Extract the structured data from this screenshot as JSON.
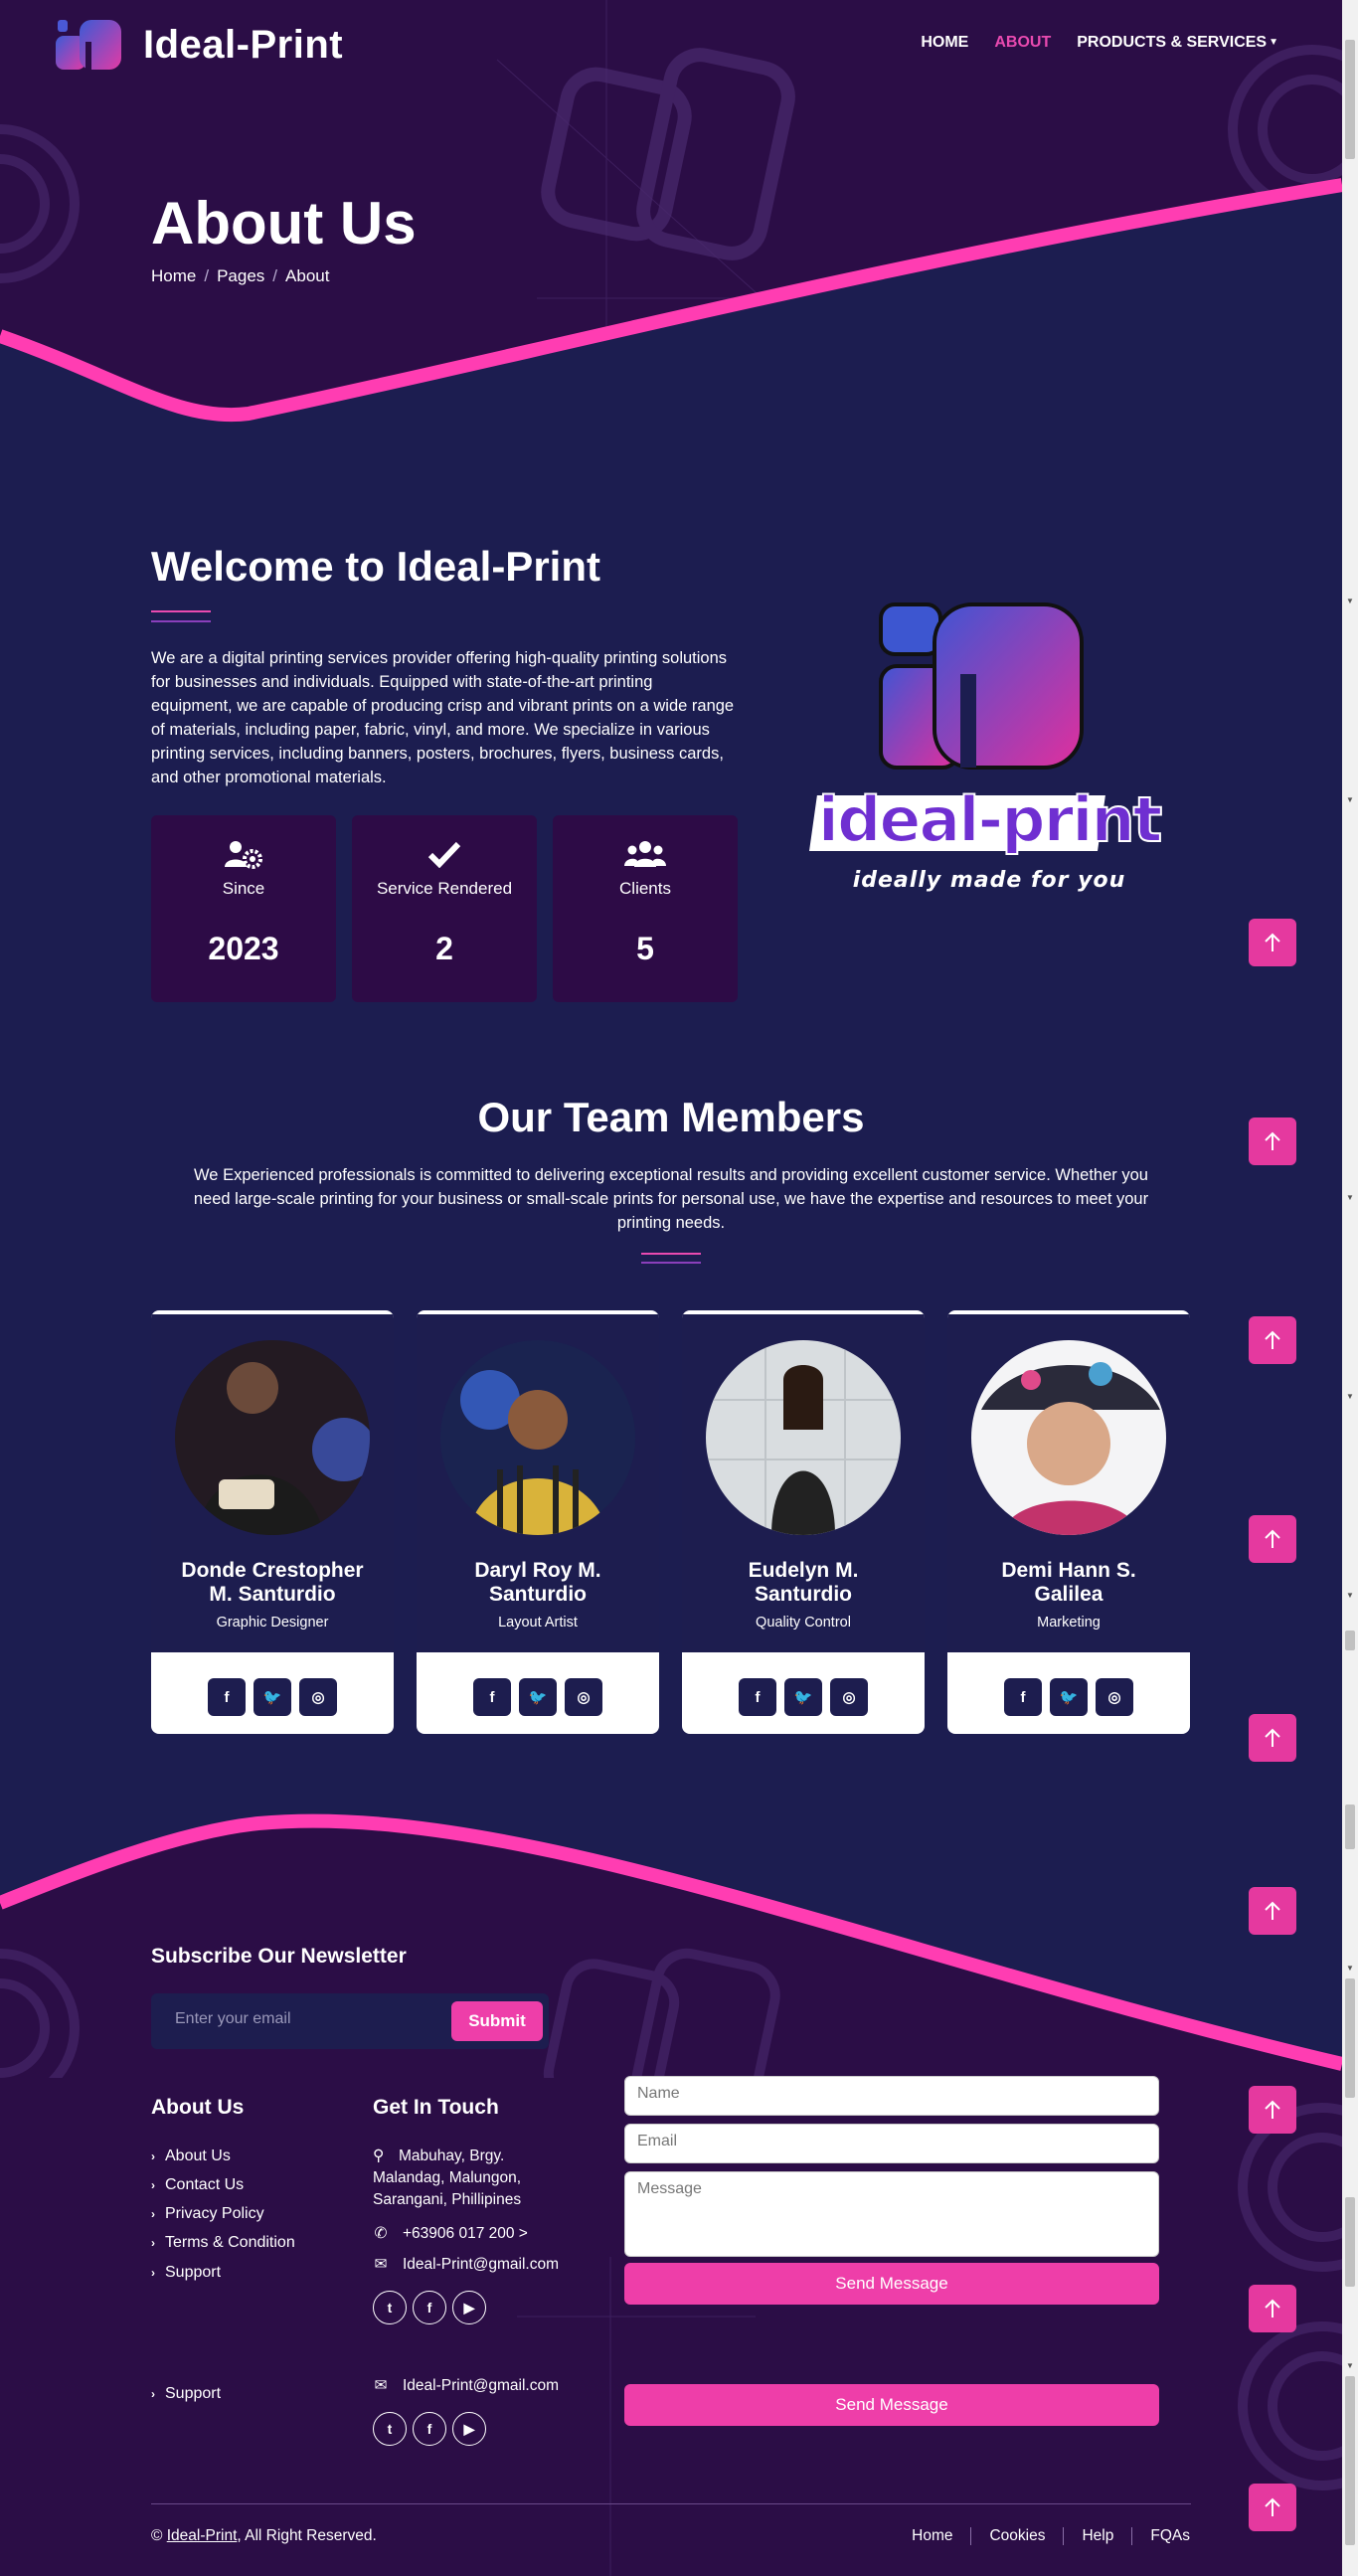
{
  "brand": {
    "name": "Ideal-Print"
  },
  "nav": {
    "items": [
      "HOME",
      "ABOUT",
      "PRODUCTS & SERVICES"
    ]
  },
  "hero": {
    "title": "About Us",
    "breadcrumb": [
      "Home",
      "Pages",
      "About"
    ]
  },
  "welcome": {
    "title": "Welcome to Ideal-Print",
    "text": "We are a digital printing services provider offering high-quality printing solutions for businesses and individuals. Equipped with state-of-the-art printing equipment, we are capable of producing crisp and vibrant prints on a wide range of materials, including paper, fabric, vinyl, and more. We specialize in various printing services, including banners, posters, brochures, flyers, business cards, and other promotional materials.",
    "stats": [
      {
        "icon": "users-cog-icon",
        "label": "Since",
        "value": "2023"
      },
      {
        "icon": "check-icon",
        "label": "Service Rendered",
        "value": "2"
      },
      {
        "icon": "users-icon",
        "label": "Clients",
        "value": "5"
      }
    ],
    "logo": {
      "wordmark": "ideal-print",
      "tagline": "ideally made for you"
    }
  },
  "team": {
    "title": "Our Team Members",
    "description": "We Experienced professionals is committed to delivering exceptional results and providing excellent customer service. Whether you need large-scale printing for your business or small-scale prints for personal use, we have the expertise and resources to meet your printing needs.",
    "members": [
      {
        "name": "Donde Crestopher M. Santurdio",
        "role": "Graphic Designer"
      },
      {
        "name": "Daryl Roy M. Santurdio",
        "role": "Layout Artist"
      },
      {
        "name": "Eudelyn M. Santurdio",
        "role": "Quality Control"
      },
      {
        "name": "Demi Hann S. Galilea",
        "role": "Marketing"
      }
    ],
    "social_icons": [
      "facebook-icon",
      "twitter-icon",
      "instagram-icon"
    ]
  },
  "footer": {
    "newsletter": {
      "title": "Subscribe Our Newsletter",
      "placeholder": "Enter your email",
      "button": "Submit"
    },
    "about": {
      "title": "About Us",
      "links": [
        "About Us",
        "Contact Us",
        "Privacy Policy",
        "Terms & Condition",
        "Support"
      ],
      "extra_link": "Support"
    },
    "contact": {
      "title": "Get In Touch",
      "address": "Mabuhay, Brgy. Malandag, Malungon, Sarangani, Phillipines",
      "phone": "+63906 017 200 >",
      "email": "Ideal-Print@gmail.com",
      "social_icons": [
        "twitter-icon",
        "facebook-icon",
        "youtube-icon"
      ]
    },
    "form": {
      "name_placeholder": "Name",
      "email_placeholder": "Email",
      "message_placeholder": "Message",
      "button": "Send Message"
    },
    "copyright": {
      "prefix": "©",
      "brand": "Ideal-Print",
      "suffix": ", All Right Reserved."
    },
    "bottom_links": [
      "Home",
      "Cookies",
      "Help",
      "FQAs"
    ]
  },
  "colors": {
    "accent": "#ee3ea9",
    "navy": "#1c1d50",
    "purple": "#2b0d46"
  }
}
